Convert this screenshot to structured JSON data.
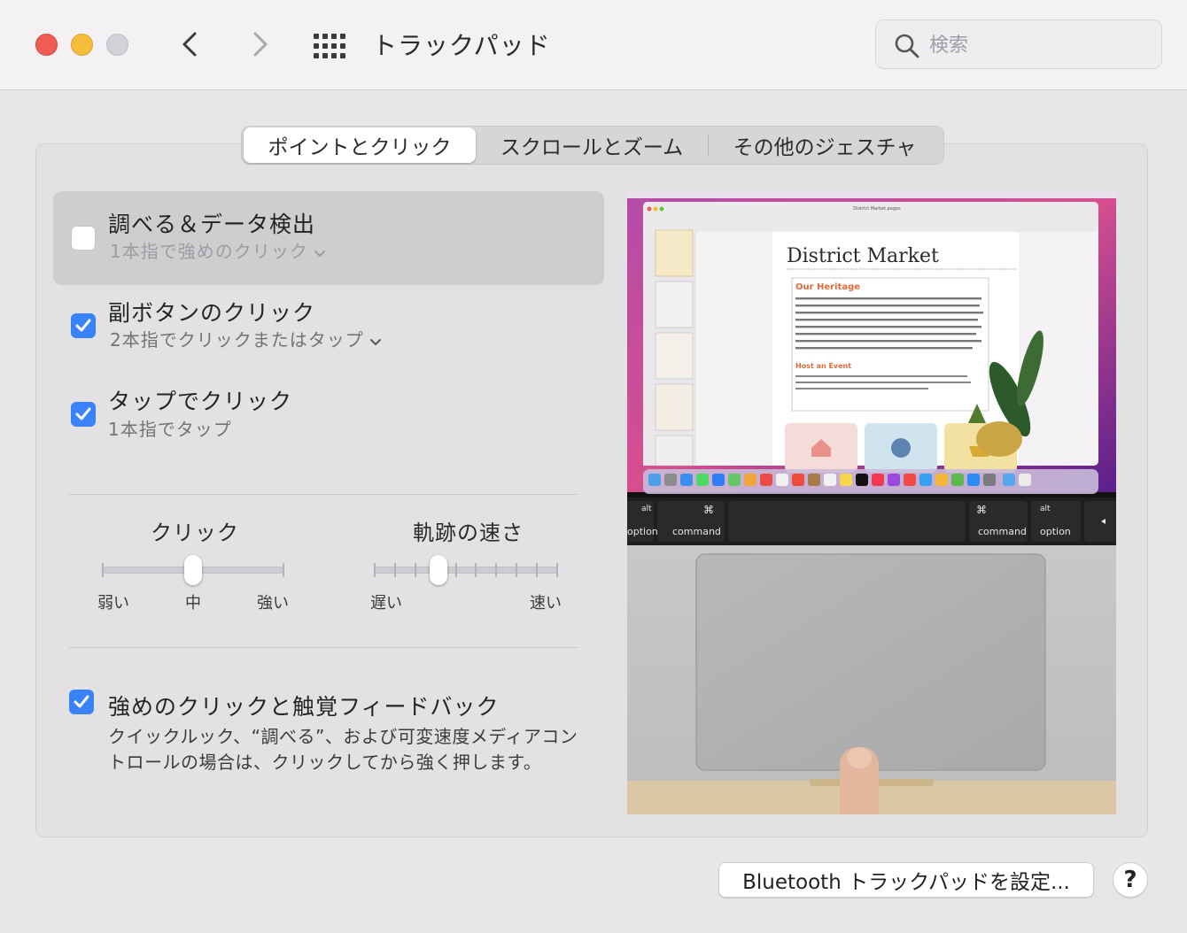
{
  "window": {
    "title": "トラックパッド",
    "search_placeholder": "検索"
  },
  "tabs": [
    {
      "label": "ポイントとクリック",
      "active": true
    },
    {
      "label": "スクロールとズーム",
      "active": false
    },
    {
      "label": "その他のジェスチャ",
      "active": false
    }
  ],
  "options": [
    {
      "title": "調べる＆データ検出",
      "subtitle": "1本指で強めのクリック",
      "checked": false,
      "has_dropdown": true
    },
    {
      "title": "副ボタンのクリック",
      "subtitle": "2本指でクリックまたはタップ",
      "checked": true,
      "has_dropdown": true
    },
    {
      "title": "タップでクリック",
      "subtitle": "1本指でタップ",
      "checked": true,
      "has_dropdown": false
    }
  ],
  "sliders": {
    "click": {
      "label": "クリック",
      "min_label": "弱い",
      "mid_label": "中",
      "max_label": "強い",
      "value_fraction": 0.5
    },
    "tracking": {
      "label": "軌跡の速さ",
      "min_label": "遅い",
      "max_label": "速い",
      "value_fraction": 0.35
    }
  },
  "force_click": {
    "title": "強めのクリックと触覚フィードバック",
    "checked": true,
    "description": "クイックルック、“調べる”、および可変速度メディアコントロールの場合は、クリックしてから強く押します。"
  },
  "preview": {
    "document_title": "District Market",
    "file_name": "District Market.pages",
    "heading1": "Our Heritage",
    "body1": "Janet Millet's little sandwich truck sure has traveled far. A decade ago she opened a mobile sandwich shop in Northern California, taking inspiration from her native New Orleans and the broader American South. The truck's success led her to open the store District Market in Oakland, featuring prepared favorites from jambalaya to gumbo, as well as specialty desserts, unique beverages, and pantry necessities. Then she opened District Markets far and wide, with locations in Brooklyn, London, and Montréal.",
    "heading2": "Host an Event",
    "body2": "Whether you want to rent our space or have us cater an event, we offer full service at all four locations (Brooklyn, London, Montréal, and Oakland) and can accommodate all appetites.",
    "keys": {
      "alt": "alt",
      "option": "option",
      "command": "command",
      "cmd_symbol": "⌘"
    }
  },
  "bottom": {
    "bluetooth_button": "Bluetooth トラックパッドを設定...",
    "help_button": "?"
  }
}
